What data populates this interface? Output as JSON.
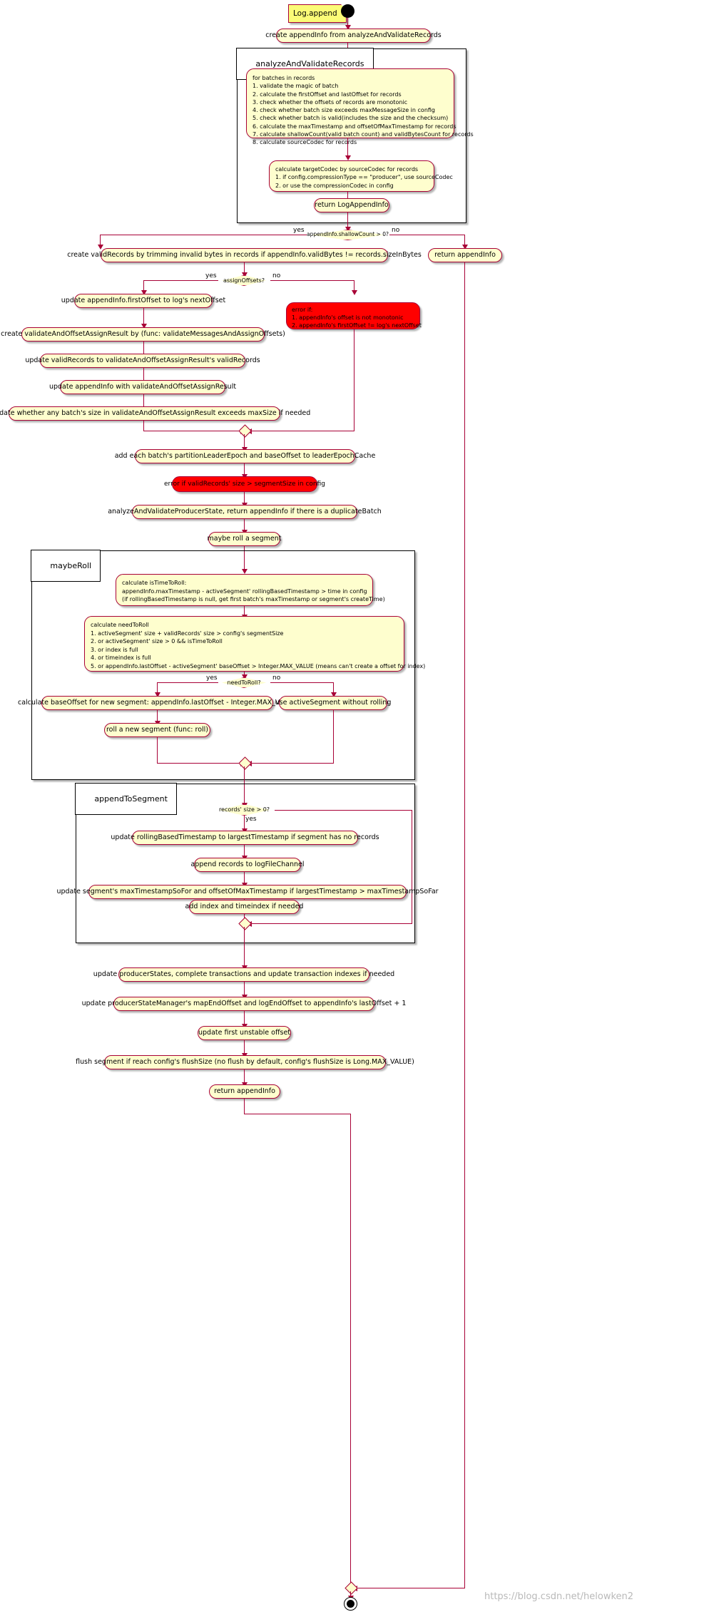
{
  "diagram": {
    "title_note": "Log.append",
    "watermark": "https://blog.csdn.net/helowken2"
  },
  "partitions": {
    "analyze": "analyzeAndValidateRecords",
    "maybe_roll": "maybeRoll",
    "append_to_segment": "appendToSegment"
  },
  "nodes": {
    "create_append_info": "create appendInfo from analyzeAndValidateRecords",
    "validate_list": "for batches in records\n1. validate the magic of batch\n2. calculate the firstOffset and lastOffset for records\n3. check whether the offsets of records are monotonic\n4. check whether batch size exceeds maxMessageSize in config\n5. check whether batch is valid(includes the size and the checksum)\n6. calculate the maxTimestamp and offsetOfMaxTimestamp for records\n7. calculate shallowCount(valid batch count) and validBytesCount for records\n8. calculate sourceCodec for records",
    "target_codec": "calculate targetCodec by sourceCodec for records\n1. if config.compressionType == \"producer\", use sourceCodec\n2. or use the compressionCodec in config",
    "return_log_append_info": "return LogAppendInfo",
    "create_valid_records": "create validRecords by trimming invalid bytes in records if appendInfo.validBytes != records.sizeInBytes",
    "return_append_info_right": "return appendInfo",
    "update_first_offset": "update appendInfo.firstOffset to log's nextOffset",
    "error_offsets": "error if:\n1. appendInfo's offset is not monotonic\n2. appendInfo's firstOffset != log's nextOffset",
    "create_validate_assign": "create validateAndOffsetAssignResult by (func: validateMessagesAndAssignOffsets)",
    "update_valid_records": "update validRecords to validateAndOffsetAssignResult's validRecords",
    "update_append_info": "update appendInfo with validateAndOffsetAssignResult",
    "revalidate_batch_size": "re-validate whether any batch's size in validateAndOffsetAssignResult exceeds maxSize if needed",
    "add_leader_epoch": "add each batch's partitionLeaderEpoch and baseOffset to leaderEpochCache",
    "error_segment_size": "error if validRecords' size > segmentSize in config",
    "analyze_producer_state": "analyzeAndValidateProducerState, return appendInfo if there is a duplicateBatch",
    "maybe_roll_a_segment": "maybe roll a segment",
    "is_time_to_roll": "calculate isTimeToRoll:\nappendInfo.maxTimestamp - activeSegment' rollingBasedTimestamp > time in config\n(if rollingBasedTimestamp is null, get first batch's maxTimestamp or segment's createTime)",
    "need_to_roll": "calculate needToRoll\n1. activeSegment' size + validRecords' size > config's segmentSize\n2. or activeSegment' size > 0 && isTimeToRoll\n3. or index is full\n4. or timeindex is full\n5. or appendInfo.lastOffset - activeSegment' baseOffset > Integer.MAX_VALUE (means can't create a offset for index)",
    "calc_base_offset": "calculate baseOffset for new segment: appendInfo.lastOffset - Integer.MAX_VALUE",
    "use_active_segment": "use activeSegment without rolling",
    "roll_new_segment": "roll a new segment (func: roll)",
    "update_rolling_timestamp": "update rollingBasedTimestamp to largestTimestamp if segment has no records",
    "append_records_channel": "append records to logFileChannel",
    "update_max_timestamp": "update segment's maxTimestampSoFor and offsetOfMaxTimestamp if largestTimestamp > maxTimestampSoFar",
    "add_index": "add index and timeindex if needed",
    "update_producer_states": "update producerStates, complete transactions and update transaction indexes if needed",
    "update_producer_manager": "update producerStateManager's mapEndOffset and logEndOffset to appendInfo's lastOffset + 1",
    "update_unstable_offset": "update first unstable offset",
    "flush_segment": "flush segment if reach config's flushSize (no flush by default, config's flushSize is Long.MAX_VALUE)",
    "return_append_info_bottom": "return appendInfo"
  },
  "decisions": {
    "shallow_count": {
      "label": "appendInfo.shallowCount > 0?",
      "yes": "yes",
      "no": "no"
    },
    "assign_offsets": {
      "label": "assignOffsets?",
      "yes": "yes",
      "no": "no"
    },
    "need_to_roll": {
      "label": "needToRoll?",
      "yes": "yes",
      "no": "no"
    },
    "records_size": {
      "label": "records' size > 0?",
      "yes": "yes",
      "no": ""
    }
  },
  "colors": {
    "activity_fill": "#FEFECE",
    "activity_border": "#A80036",
    "error_fill": "#FF0000",
    "note_fill": "#FBFB77",
    "partition_border": "#000000"
  }
}
